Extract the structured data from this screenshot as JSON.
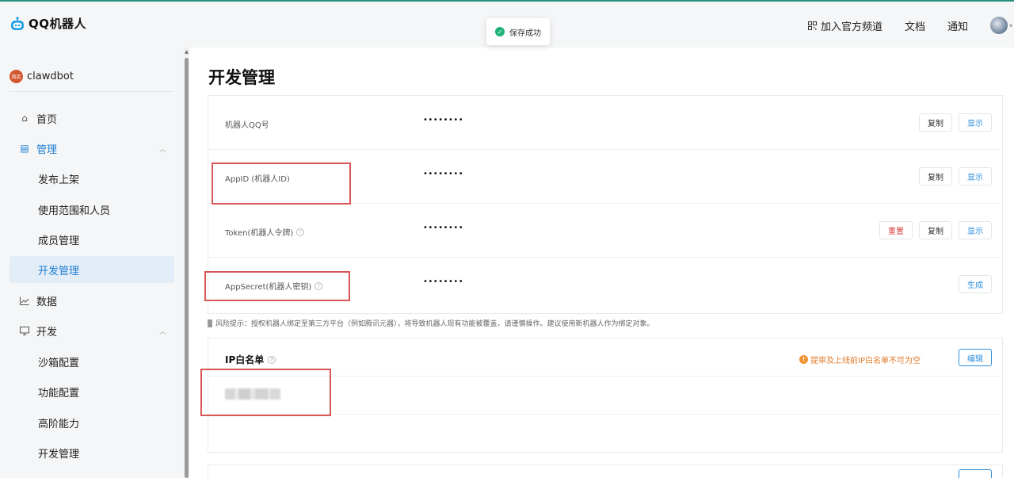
{
  "header": {
    "brand": "QQ机器人",
    "nav": {
      "channel": "加入官方频道",
      "docs": "文档",
      "notify": "通知"
    }
  },
  "toast": {
    "text": "保存成功"
  },
  "sidebar": {
    "bot_badge": "商店",
    "bot_name": "clawdbot",
    "items": {
      "home": "首页",
      "manage": "管理",
      "publish": "发布上架",
      "scope": "使用范围和人员",
      "members": "成员管理",
      "devmanage": "开发管理",
      "data": "数据",
      "develop": "开发",
      "sandbox": "沙箱配置",
      "features": "功能配置",
      "advanced": "高阶能力",
      "devmanage2": "开发管理"
    }
  },
  "main": {
    "title": "开发管理",
    "credentials": [
      {
        "label": "机器人QQ号",
        "value": "••••••••",
        "buttons": [
          "复制",
          "显示"
        ]
      },
      {
        "label": "AppID (机器人ID)",
        "value": "••••••••",
        "buttons": [
          "复制",
          "显示"
        ]
      },
      {
        "label": "Token(机器人令牌)",
        "value": "••••••••",
        "buttons": [
          "重置",
          "复制",
          "显示"
        ]
      },
      {
        "label": "AppSecret(机器人密钥)",
        "value": "••••••••",
        "buttons": [
          "生成"
        ]
      }
    ],
    "risk_notice": "风险提示：授权机器人绑定至第三方平台（例如腾讯元器），将导致机器人现有功能被覆盖，请谨慎操作。建议使用新机器人作为绑定对象。",
    "ip_whitelist": {
      "title": "IP白名单",
      "warning": "提审及上线前IP白名单不可为空",
      "edit": "编辑"
    }
  },
  "colors": {
    "accent": "#1e7fd1",
    "highlight": "#d95656",
    "success": "#1fb37a",
    "warning": "#f0922c"
  }
}
